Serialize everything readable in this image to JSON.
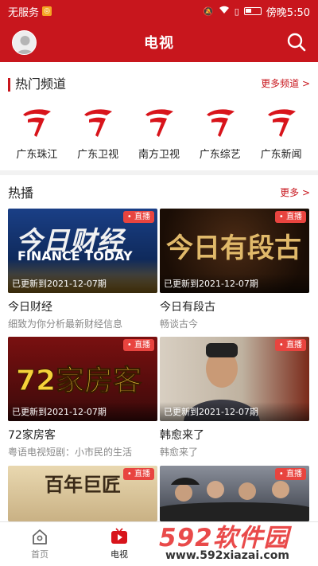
{
  "status_bar": {
    "carrier": "无服务",
    "time": "傍晚5:50"
  },
  "app_bar": {
    "title": "电视"
  },
  "channels_section": {
    "title": "热门频道",
    "more_label": "更多频道 >",
    "channels": [
      {
        "name": "广东珠江"
      },
      {
        "name": "广东卫视"
      },
      {
        "name": "南方卫视"
      },
      {
        "name": "广东综艺"
      },
      {
        "name": "广东新闻"
      }
    ]
  },
  "hot_section": {
    "title": "热播",
    "more_label": "更多 >",
    "programs": [
      {
        "title": "今日财经",
        "desc": "细致为你分析最新财经信息",
        "badge": "直播",
        "updated": "已更新到2021-12-07期",
        "thumb_text": "今日财经",
        "thumb_sub": "FINANCE TODAY"
      },
      {
        "title": "今日有段古",
        "desc": "畅谈古今",
        "badge": "直播",
        "updated": "已更新到2021-12-07期",
        "thumb_text": "今日有段古"
      },
      {
        "title": "72家房客",
        "desc": "粤语电视短剧：小市民的生活",
        "badge": "直播",
        "updated": "已更新到2021-12-07期",
        "thumb_text": "72家房客"
      },
      {
        "title": "韩愈来了",
        "desc": "韩愈来了",
        "badge": "直播",
        "updated": "已更新到2021-12-07期"
      },
      {
        "badge": "直播",
        "thumb_text": "百年巨匠"
      },
      {
        "badge": "直播"
      }
    ]
  },
  "tab_bar": {
    "home": "首页",
    "tv": "电视"
  },
  "watermark": {
    "big": "592软件园",
    "small": "www.592xiazai.com"
  },
  "colors": {
    "brand": "#c8161d",
    "live_badge": "#e8443f"
  }
}
